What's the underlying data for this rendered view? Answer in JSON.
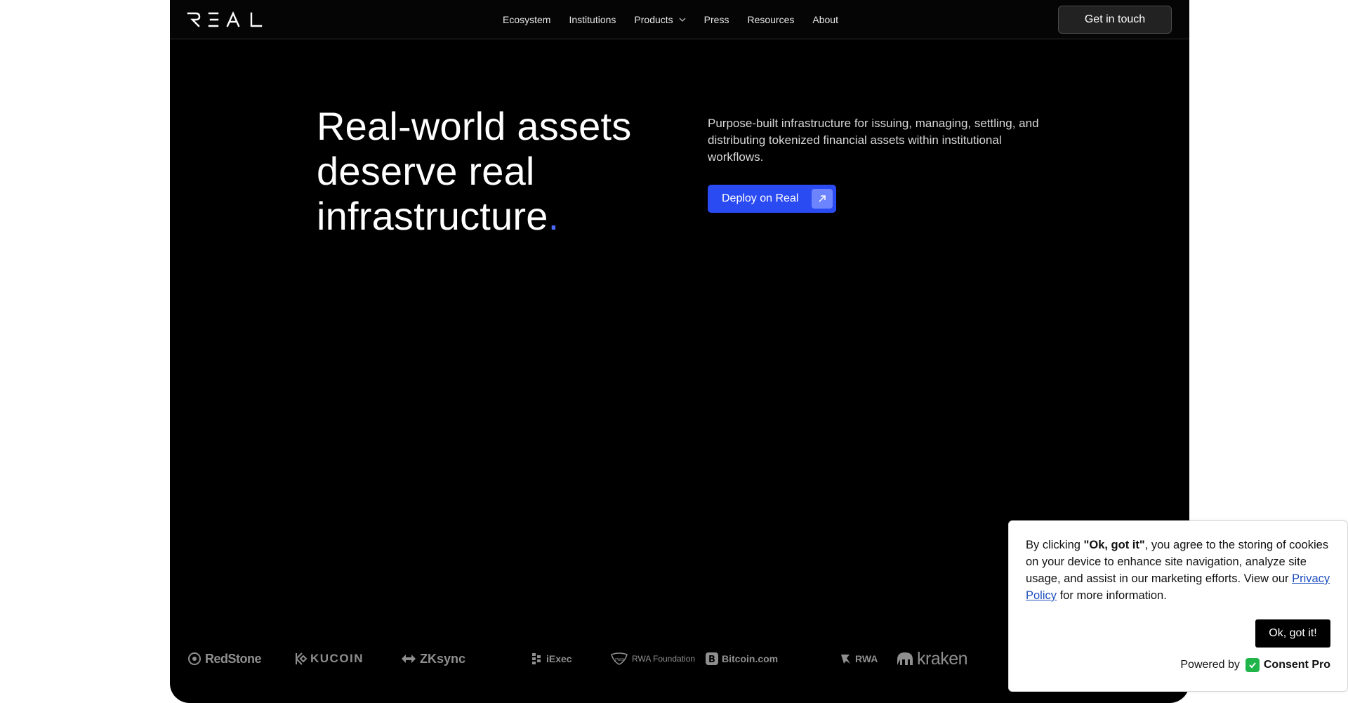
{
  "nav": {
    "logo_text": "REAL",
    "links": [
      "Ecosystem",
      "Institutions",
      "Products",
      "Press",
      "Resources",
      "About"
    ],
    "cta": "Get in touch"
  },
  "hero": {
    "title_line1": "Real-world assets",
    "title_line2": "deserve real",
    "title_line3": "infrastructure",
    "title_dot": ".",
    "description": "Purpose-built infrastructure for issuing, managing, settling, and distributing tokenized financial assets within institutional workflows.",
    "deploy_label": "Deploy on Real"
  },
  "partners": [
    "RedStone",
    "KUCOIN",
    "ZKsync",
    "iExec",
    "RWA Foundation",
    "Bitcoin.com",
    "RWA",
    "kraken"
  ],
  "cookie": {
    "prefix": "By clicking ",
    "bold": "\"Ok, got it\"",
    "middle": ", you agree to the storing of cookies on your device to enhance site navigation, analyze site usage, and assist in our marketing efforts. View our ",
    "link": "Privacy Policy",
    "suffix": " for more information.",
    "ok_label": "Ok, got it!",
    "powered_by": "Powered by",
    "brand": "Consent Pro"
  },
  "colors": {
    "accent": "#2b4bf2",
    "dot": "#4b6bff",
    "consent_brand": "#1fb54a"
  }
}
